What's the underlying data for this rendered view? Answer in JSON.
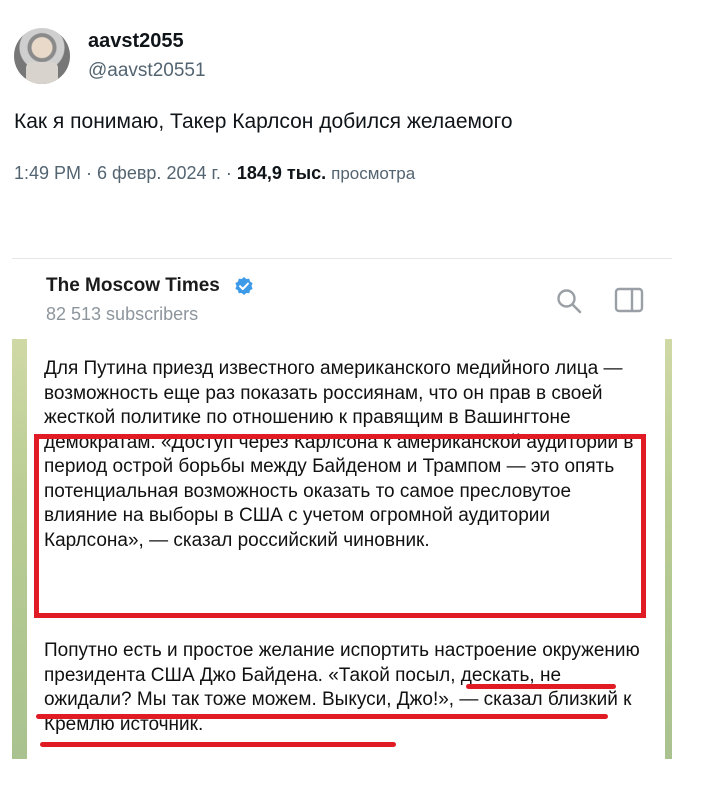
{
  "tweet": {
    "display_name": "aavst2055",
    "handle": "@aavst20551",
    "text": "Как я понимаю, Такер Карлсон добился желаемого",
    "time": "1:49 PM · 6 февр. 2024 г. · ",
    "views_count": "184,9 тыс.",
    "views_label": "просмотра"
  },
  "telegram": {
    "channel_name": "The Moscow Times",
    "subscribers": "82 513 subscribers",
    "icons": [
      "verified-icon",
      "search-icon",
      "side-panel-icon"
    ],
    "paragraph1": "Для Путина приезд известного американского медийного лица — возможность еще раз показать россиянам, что он прав в своей жесткой политике по отношению к правящим в Вашингтоне демократам. «Доступ через Карлсона к американской аудитории в период острой борьбы между Байденом и Трампом — это опять потенциальная возможность оказать то самое пресловутое влияние на выборы в США с учетом огромной аудитории Карлсона», — сказал российский чиновник.",
    "paragraph2": "Попутно есть и простое желание испортить настроение окружению президента США Джо Байдена. «Такой посыл, дескать, не ожидали? Мы так тоже можем. Выкуси, Джо!», — сказал близкий к Кремлю источник."
  },
  "colors": {
    "highlight_red": "#e01b24",
    "verified_blue": "#3d9ae8",
    "muted_gray": "#536471"
  }
}
